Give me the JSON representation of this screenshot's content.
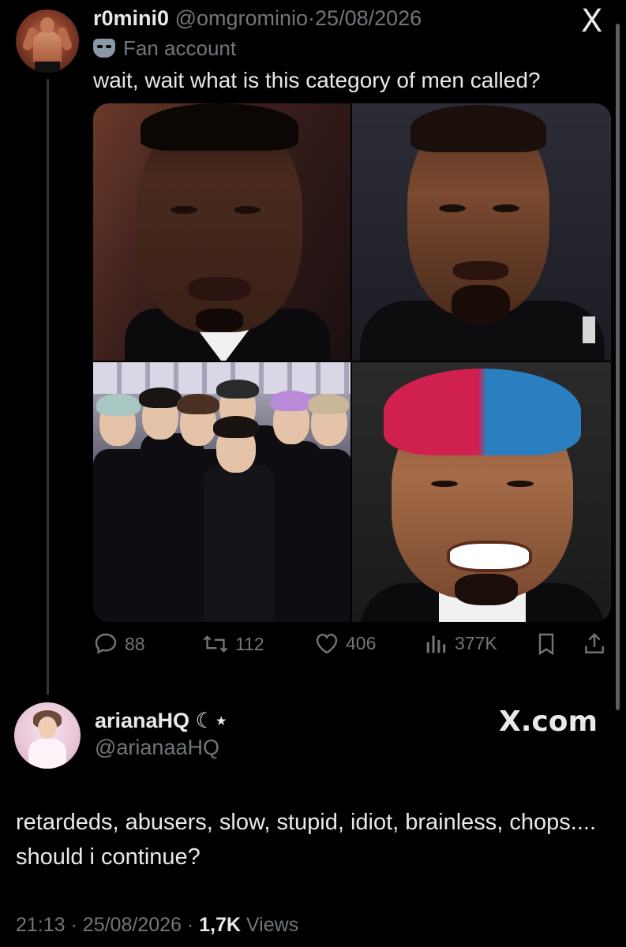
{
  "parent": {
    "display_name": "r0mini0",
    "handle": "@omgrominio",
    "separator": "·",
    "date": "25/08/2026",
    "label": "Fan account",
    "text": "wait, wait what is this category of men called?",
    "stats": {
      "replies": "88",
      "reposts": "112",
      "likes": "406",
      "views": "377K"
    }
  },
  "logo": "X",
  "reply": {
    "display_name": "arianaHQ ☾⋆",
    "handle": "@arianaaHQ",
    "watermark": "X.com",
    "text": "retardeds, abusers, slow, stupid, idiot, brainless, chops.... should i continue?",
    "time": "21:13",
    "date": "25/08/2026",
    "views_count": "1,7K",
    "views_label": "Views",
    "separator": "·"
  },
  "colors": {
    "background": "#000000",
    "primary_text": "#e7e9ea",
    "secondary_text": "#71767b"
  }
}
